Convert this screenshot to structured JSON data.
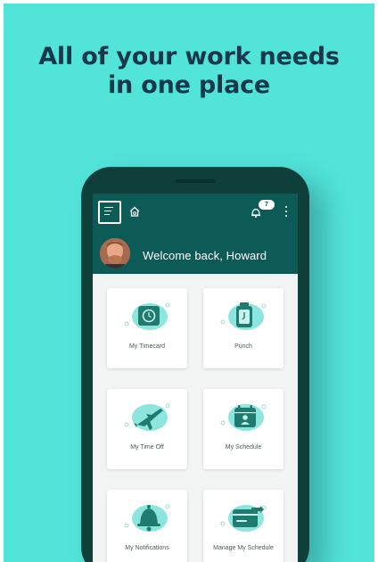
{
  "headline": {
    "line1": "All of your work needs",
    "line2": "in one place"
  },
  "appbar": {
    "notification_count": "7",
    "welcome_text": "Welcome back, Howard"
  },
  "tiles": [
    {
      "label": "My Timecard",
      "icon": "timecard-icon"
    },
    {
      "label": "Punch",
      "icon": "punch-clock-icon"
    },
    {
      "label": "My Time Off",
      "icon": "airplane-icon"
    },
    {
      "label": "My Schedule",
      "icon": "calendar-person-icon"
    },
    {
      "label": "My Notifications",
      "icon": "bell-icon"
    },
    {
      "label": "Manage My Schedule",
      "icon": "calendar-edit-icon"
    }
  ],
  "colors": {
    "background": "#52e3d9",
    "phone": "#0f3f3a",
    "appbar": "#0d5b56",
    "accent": "#1f7a6f",
    "headline": "#16384a"
  }
}
